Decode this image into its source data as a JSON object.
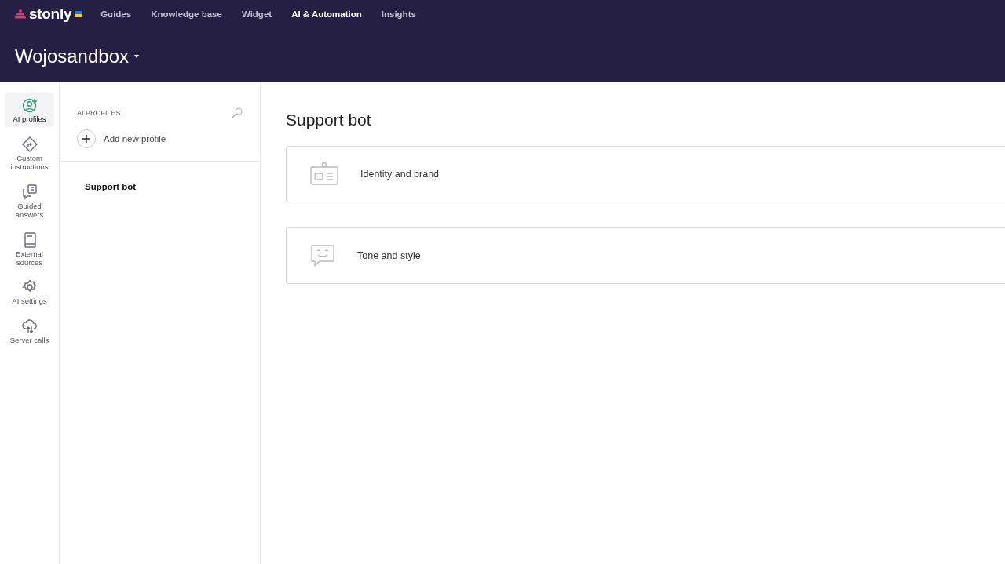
{
  "brand": {
    "name": "stonly"
  },
  "nav": [
    {
      "label": "Guides",
      "selected": false
    },
    {
      "label": "Knowledge base",
      "selected": false
    },
    {
      "label": "Widget",
      "selected": false
    },
    {
      "label": "AI & Automation",
      "selected": true
    },
    {
      "label": "Insights",
      "selected": false
    }
  ],
  "workspace": {
    "title": "Wojosandbox"
  },
  "sidebar": {
    "items": [
      {
        "kind": "profile",
        "label": "AI profiles",
        "selected": true
      },
      {
        "kind": "instructions",
        "label": "Custom instructions",
        "selected": false
      },
      {
        "kind": "answers",
        "label": "Guided answers",
        "selected": false
      },
      {
        "kind": "sources",
        "label": "External sources",
        "selected": false
      },
      {
        "kind": "settings",
        "label": "AI settings",
        "selected": false
      },
      {
        "kind": "server",
        "label": "Server calls",
        "selected": false
      }
    ]
  },
  "profiles": {
    "heading": "AI PROFILES",
    "add_label": "Add new profile",
    "items": [
      {
        "label": "Support bot",
        "selected": true
      }
    ]
  },
  "main": {
    "title": "Support bot",
    "cards": [
      {
        "kind": "identity",
        "label": "Identity and brand"
      },
      {
        "kind": "tone",
        "label": "Tone and style"
      }
    ]
  }
}
